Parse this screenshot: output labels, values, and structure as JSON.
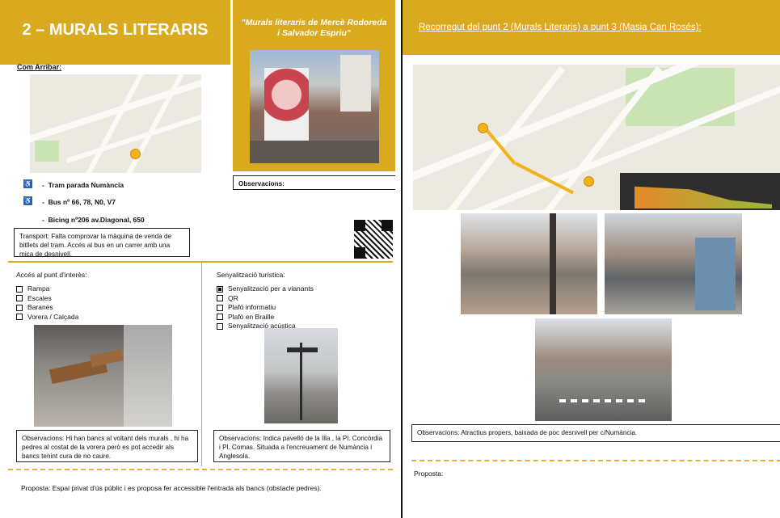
{
  "left": {
    "title": "2 – MURALS LITERARIS",
    "mural_caption": "\"Murals literaris de Mercè Rodoreda i Salvador Espriu\"",
    "how_to_arrive": "Com Arribar:",
    "observations_label": "Observacions:",
    "transport_items": [
      "Tram parada Numància",
      "Bus nº 66, 78, N0, V7",
      "Bicing nº206 av.Diagonal, 650"
    ],
    "transport_note": "Transport: Falta comprovar la màquina de venda de bitllets del tram. Accés al bus en un carrer amb una mica de desnivell.",
    "access_title": "Accés al punt d'interès:",
    "access_items": [
      "Rampa",
      "Escales",
      "Baranes",
      "Vorera / Calçada"
    ],
    "signage_title": "Senyalització turística:",
    "signage_items": [
      {
        "label": "Senyalització per a vianants",
        "checked": true
      },
      {
        "label": "QR",
        "checked": false
      },
      {
        "label": "Plafó informatiu",
        "checked": false
      },
      {
        "label": "Plafó en Braille",
        "checked": false
      },
      {
        "label": "Senyalització acústica",
        "checked": false
      }
    ],
    "obs_access": "Observacions: Hi han bancs al voltant dels murals , hi ha pedres al costat de la vorera però es pot accedir als bancs tenint cura de no caure.",
    "obs_signage": "Observacions: Indica pavelló de la Illa , la Pl. Concòrdia i Pl. Comas. Situada a l'encreuament de Numància i Anglesola.",
    "proposal": "Proposta: Espai privat d'ús públic i es proposa fer accessible l'entrada als bancs (obstacle pedres)."
  },
  "right": {
    "title": "Recorregut del punt 2 (Murals Literaris) a punt 3 (Masia Can Rosés):",
    "observations": "Observacions: Atractius propers, baixada de poc desnivell per c/Numància.",
    "proposal": "Proposta:"
  },
  "colors": {
    "accent": "#d9a91e"
  }
}
